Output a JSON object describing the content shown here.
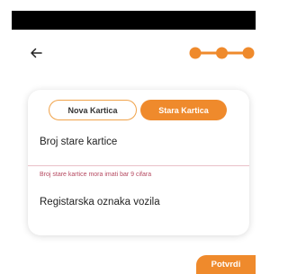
{
  "colors": {
    "accent": "#ef8a2c",
    "status_bar": "#000000",
    "error_text": "#b64a61"
  },
  "header": {
    "back_icon": "arrow-left-icon",
    "step_count": 3
  },
  "card_type_toggle": {
    "new_label": "Nova Kartica",
    "old_label": "Stara Kartica",
    "selected": "Stara Kartica"
  },
  "form": {
    "card_number_label": "Broj stare kartice",
    "card_number_error": "Broj stare kartice mora imati bar 9 cifara",
    "plate_label": "Registarska oznaka vozila"
  },
  "footer": {
    "confirm_label": "Potvrdi"
  }
}
